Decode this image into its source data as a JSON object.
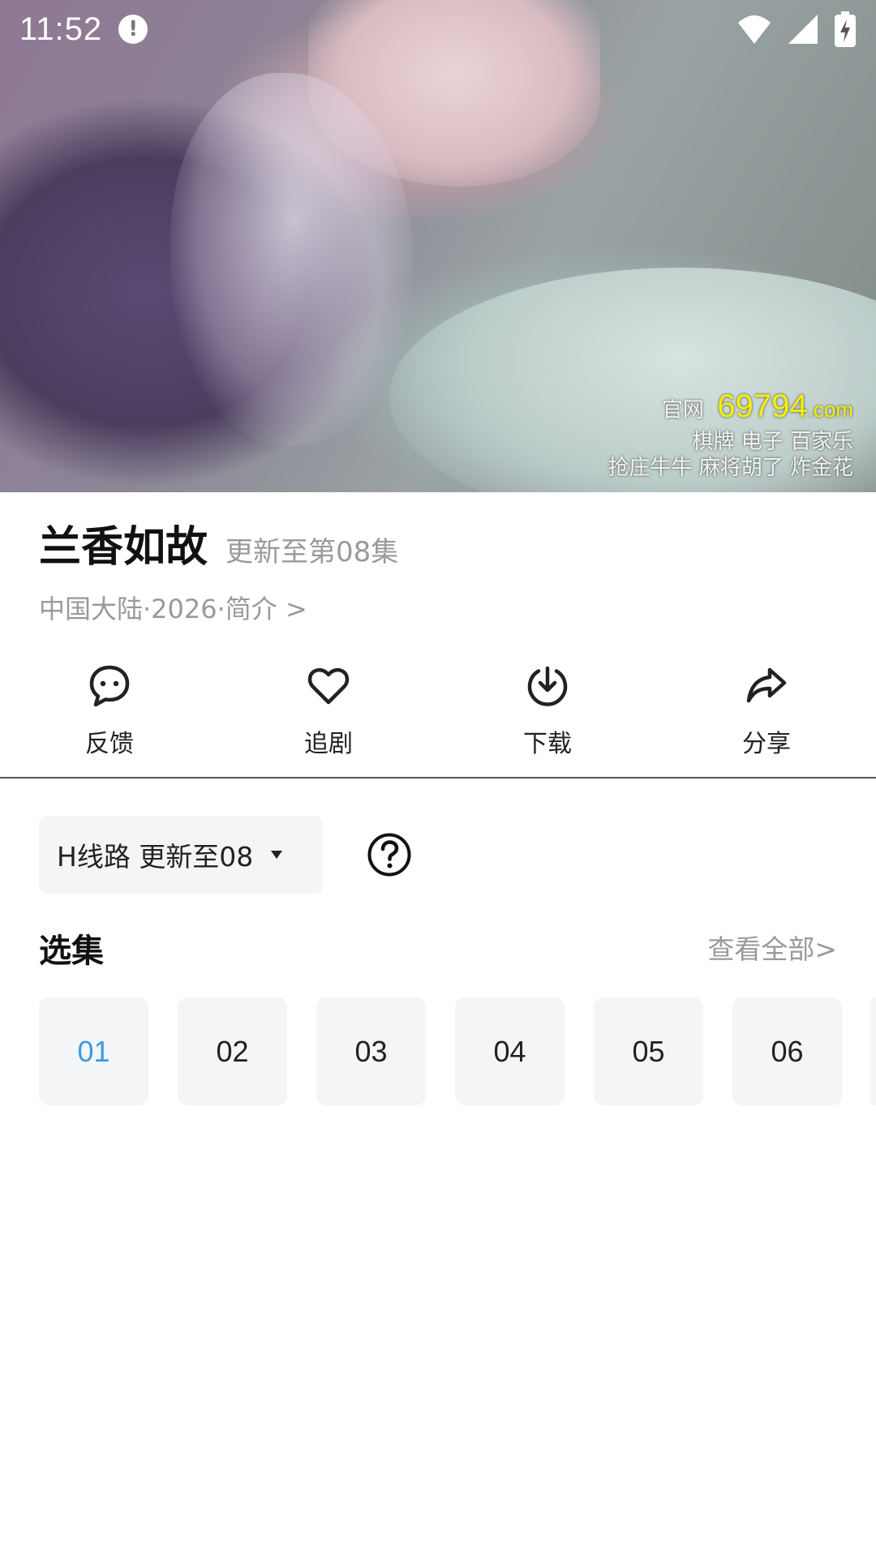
{
  "status_bar": {
    "time": "11:52"
  },
  "video": {
    "watermark": {
      "prefix": "官网",
      "number": "69794",
      "domain": ".com",
      "line2": "棋牌  电子  百家乐",
      "line3": "抢庄牛牛  麻将胡了  炸金花"
    }
  },
  "show": {
    "title": "兰香如故",
    "update_status": "更新至第08集",
    "meta": "中国大陆·2026·简介 >"
  },
  "actions": [
    {
      "label": "反馈",
      "icon": "feedback-icon"
    },
    {
      "label": "追剧",
      "icon": "heart-icon"
    },
    {
      "label": "下载",
      "icon": "download-icon"
    },
    {
      "label": "分享",
      "icon": "share-icon"
    }
  ],
  "route": {
    "selected": "H线路 更新至08",
    "help_icon": "question-circle-icon"
  },
  "episodes_section": {
    "header": "选集",
    "view_all": "查看全部>",
    "items": [
      "01",
      "02",
      "03",
      "04",
      "05",
      "06"
    ],
    "active_index": 0
  },
  "colors": {
    "accent": "#3b9ae1",
    "muted_text": "#9a9a9a",
    "chip_bg": "#f4f5f7",
    "watermark_yellow": "#f6f000"
  }
}
